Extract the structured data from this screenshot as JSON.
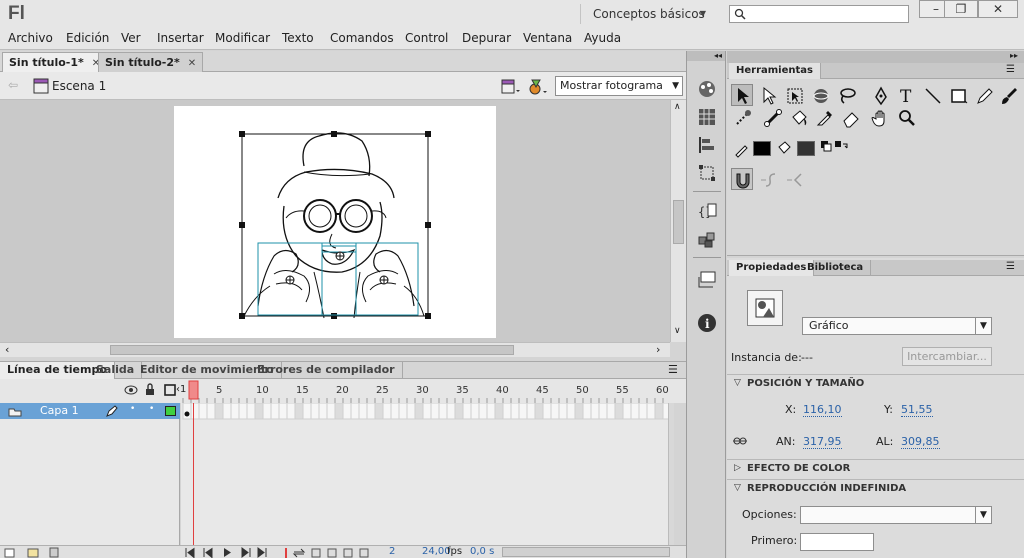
{
  "app": {
    "logo": "Fl",
    "workspace": "Conceptos básicos"
  },
  "search": {
    "placeholder": ""
  },
  "window_controls": {
    "minimize": "–",
    "restore": "❐",
    "close": "✕"
  },
  "menu": [
    "Archivo",
    "Edición",
    "Ver",
    "Insertar",
    "Modificar",
    "Texto",
    "Comandos",
    "Control",
    "Depurar",
    "Ventana",
    "Ayuda"
  ],
  "doc_tabs": [
    {
      "label": "Sin título-1*",
      "active": true
    },
    {
      "label": "Sin título-2*",
      "active": false
    }
  ],
  "scene": {
    "label": "Escena 1",
    "view_mode": "Mostrar fotograma"
  },
  "timeline": {
    "tabs": [
      "Línea de tiempo",
      "Salida",
      "Editor de movimiento",
      "Errores de compilador"
    ],
    "frame_numbers": [
      "5",
      "10",
      "15",
      "20",
      "25",
      "30",
      "35",
      "40",
      "45",
      "50",
      "55",
      "60"
    ],
    "layer_name": "Capa 1",
    "current_frame": "2",
    "fps": "24,00",
    "fps_unit": "fps",
    "time": "0,0 s"
  },
  "tools_panel": {
    "title": "Herramientas"
  },
  "properties_panel": {
    "tabs": [
      "Propiedades",
      "Biblioteca"
    ],
    "symbol_type": "Gráfico",
    "instance_label": "Instancia de:",
    "instance_value": "---",
    "swap_button": "Intercambiar...",
    "position_section": "POSICIÓN Y TAMAÑO",
    "x_label": "X:",
    "x_value": "116,10",
    "y_label": "Y:",
    "y_value": "51,55",
    "w_label": "AN:",
    "w_value": "317,95",
    "h_label": "AL:",
    "h_value": "309,85",
    "color_section": "EFECTO DE COLOR",
    "loop_section": "REPRODUCCIÓN INDEFINIDA",
    "options_label": "Opciones:",
    "options_value": "",
    "first_label": "Primero:",
    "first_value": ""
  },
  "colors": {
    "accent": "#2b62a8",
    "layer_selected": "#6aa2d6",
    "playhead": "#e04040"
  }
}
